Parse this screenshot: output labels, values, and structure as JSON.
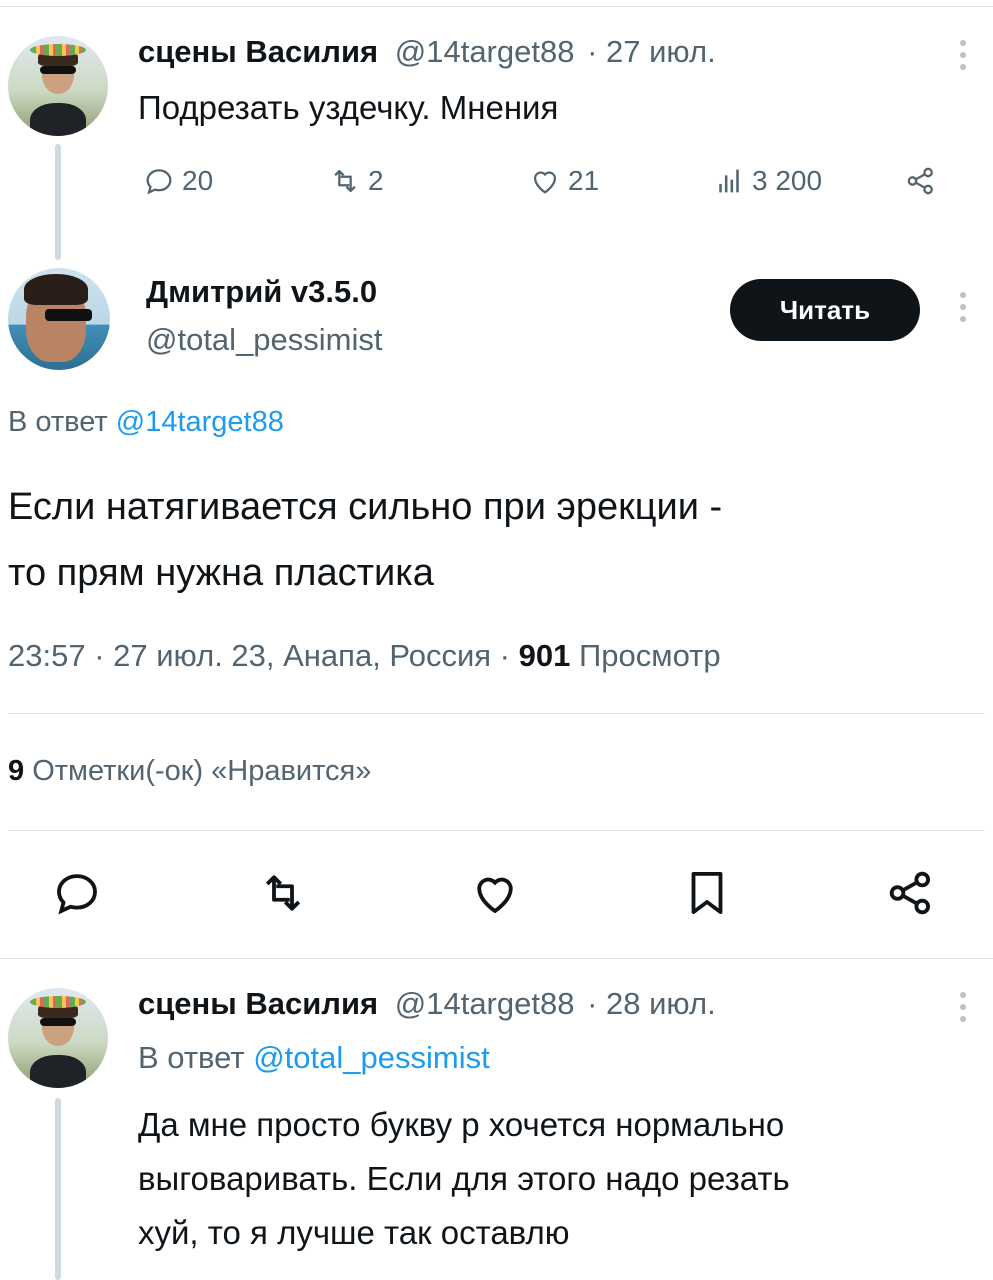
{
  "tweet1": {
    "name": "сцены Василия",
    "handle": "@14target88",
    "date": "· 27 июл.",
    "text": "Подрезать уздечку. Мнения",
    "stats": {
      "replies": "20",
      "retweets": "2",
      "likes": "21",
      "views": "3 200"
    }
  },
  "main": {
    "name": "Дмитрий v3.5.0",
    "handle": "@total_pessimist",
    "follow_label": "Читать",
    "reply_prefix": "В ответ",
    "reply_handle": "@14target88",
    "text_line1": "Если натягивается сильно при эрекции -",
    "text_line2": "то прям нужна пластика",
    "meta": "23:57 · 27 июл. 23, Анапа, Россия ·",
    "views_count": "901",
    "views_label": "Просмотр",
    "likes_count": "9",
    "likes_label": "Отметки(-ок) «Нравится»"
  },
  "tweet3": {
    "name": "сцены Василия",
    "handle": "@14target88",
    "date": "· 28 июл.",
    "reply_prefix": "В ответ",
    "reply_handle": "@total_pessimist",
    "text_line1": "Да мне просто букву р хочется нормально",
    "text_line2": "выговаривать. Если для этого надо резать",
    "text_line3": "хуй, то я лучше так оставлю"
  },
  "icons": [
    "reply-icon",
    "retweet-icon",
    "like-icon",
    "views-icon",
    "share-icon",
    "bookmark-icon",
    "more-icon"
  ],
  "colors": {
    "link": "#1d9bf0",
    "muted": "#536471",
    "button": "#0f1419"
  }
}
